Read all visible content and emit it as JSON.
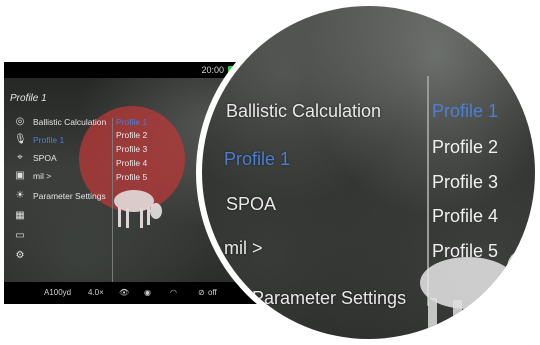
{
  "device": {
    "time": "20:00",
    "title": "Profile 1",
    "menu": [
      {
        "label": "Ballistic Calculation",
        "icon": "target-icon",
        "highlighted": false
      },
      {
        "label": "Profile 1",
        "icon": "microphone-icon",
        "highlighted": true
      },
      {
        "label": "SPOA",
        "icon": "crosshair-icon",
        "highlighted": false
      },
      {
        "label": "mil >",
        "icon": "monitor-icon",
        "highlighted": false
      },
      {
        "label": "Parameter Settings",
        "icon": "brightness-icon",
        "highlighted": false
      }
    ],
    "side_icons": [
      "grid-icon",
      "image-icon",
      "gear-icon"
    ],
    "profiles": [
      {
        "label": "Profile 1",
        "highlighted": true
      },
      {
        "label": "Profile 2",
        "highlighted": false
      },
      {
        "label": "Profile 3",
        "highlighted": false
      },
      {
        "label": "Profile 4",
        "highlighted": false
      },
      {
        "label": "Profile 5",
        "highlighted": false
      }
    ],
    "status": {
      "distance": "A100yd",
      "zoom": "4.0×",
      "wifi_off": "off"
    }
  },
  "magnified": {
    "menu": [
      "Ballistic Calculation",
      "Profile 1",
      "SPOA",
      "mil >",
      "Parameter Settings"
    ],
    "profiles": [
      "Profile 1",
      "Profile 2",
      "Profile 3",
      "Profile 4",
      "Profile 5"
    ]
  },
  "colors": {
    "highlight": "#4c7fd4",
    "overlay_red": "#be3737",
    "battery": "#2ecc40"
  }
}
